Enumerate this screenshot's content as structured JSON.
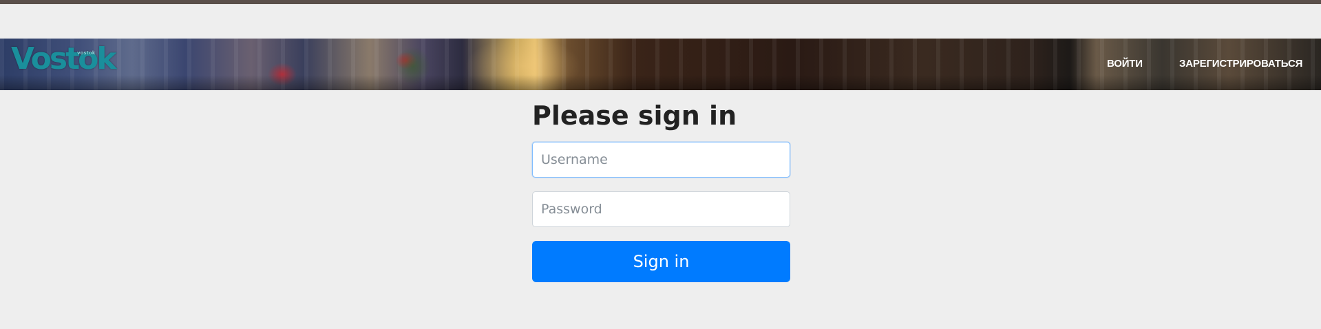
{
  "header": {
    "logo_text": "Vostok",
    "logo_sub": "vostok",
    "nav": [
      {
        "label": "ВОЙТИ"
      },
      {
        "label": "ЗАРЕГИСТРИРОВАТЬСЯ"
      }
    ]
  },
  "form": {
    "title": "Please sign in",
    "username_placeholder": "Username",
    "password_placeholder": "Password",
    "submit_label": "Sign in"
  },
  "colors": {
    "primary": "#007bff",
    "logo": "#1a8f9c",
    "background": "#eeeeee"
  }
}
